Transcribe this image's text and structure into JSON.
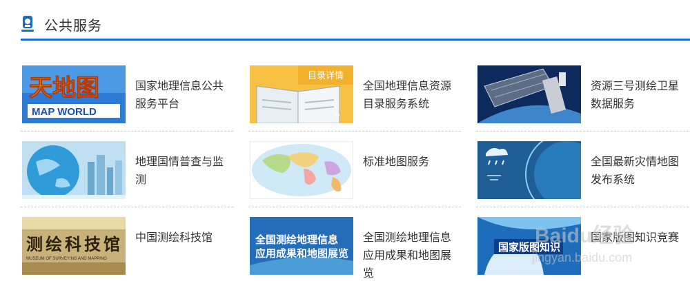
{
  "header": {
    "title": "公共服务",
    "icon": "service-icon"
  },
  "colors": {
    "accent": "#1a6dc7"
  },
  "services": [
    {
      "label": "国家地理信息公共服务平台",
      "thumb_text": [
        "天地图",
        "MAP WORLD"
      ]
    },
    {
      "label": "全国地理信息资源目录服务系统",
      "thumb_text": [
        "目录详情",
        "»"
      ]
    },
    {
      "label": "资源三号测绘卫星数据服务",
      "thumb_text": []
    },
    {
      "label": "地理国情普查与监测",
      "thumb_text": []
    },
    {
      "label": "标准地图服务",
      "thumb_text": []
    },
    {
      "label": "全国最新灾情地图发布系统",
      "thumb_text": []
    },
    {
      "label": "中国测绘科技馆",
      "thumb_text": [
        "测绘科技馆",
        "MUSEUM OF SURVEYING AND MAPPING"
      ]
    },
    {
      "label": "全国测绘地理信息应用成果和地图展览",
      "thumb_text": [
        "全国测绘地理信息",
        "应用成果和地图展览"
      ]
    },
    {
      "label": "国家版图知识竞赛",
      "thumb_text": [
        "国家版图知识"
      ]
    }
  ],
  "watermark": {
    "brand": "Baidu经验",
    "url": "jingyan.baidu.com"
  }
}
